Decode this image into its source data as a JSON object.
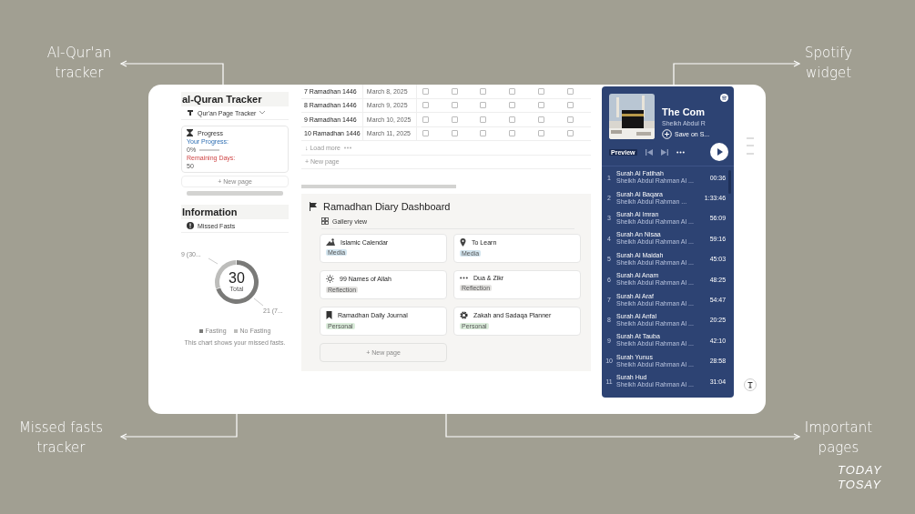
{
  "callouts": [
    "Al-Qur'an tracker",
    "Spotify widget",
    "Missed fasts tracker",
    "Important pages"
  ],
  "logo": {
    "line_1": "TODAY",
    "line_2": "TOSAY"
  },
  "quran_tracker": {
    "title": "al-Quran Tracker",
    "view": "Qur'an Page Tracker",
    "card_title": "Progress",
    "progress_label": "Your Progress:",
    "progress_value": "0%",
    "level": 0,
    "remaining_label": "Remaining Days:",
    "remaining_value": "50",
    "new_page": "+ New page"
  },
  "information": {
    "title": "Information",
    "view": "Missed Fasts",
    "center_value": "30",
    "center_label": "Total",
    "slice_labels": [
      "9 (30...",
      "21 (7..."
    ],
    "caption": "This chart shows your missed fasts.",
    "chart_data": {
      "type": "donut",
      "categories": [
        "Fasting",
        "No Fasting"
      ],
      "values": [
        70,
        30
      ]
    }
  },
  "table": {
    "rows": [
      {
        "day": "7 Ramadhan 1446",
        "date": "March 8, 2025",
        "checks": [
          false,
          false,
          false,
          false,
          false,
          false
        ]
      },
      {
        "day": "8 Ramadhan 1446",
        "date": "March 9, 2025",
        "checks": [
          false,
          false,
          false,
          false,
          false,
          false
        ]
      },
      {
        "day": "9 Ramadhan 1446",
        "date": "March 10, 2025",
        "checks": [
          false,
          false,
          false,
          false,
          false,
          false
        ]
      },
      {
        "day": "10 Ramadhan 1446",
        "date": "March 11, 2025",
        "checks": [
          false,
          false,
          false,
          false,
          false,
          false
        ]
      }
    ],
    "load_more": "↓ Load more",
    "new_page": "+ New page"
  },
  "dashboard": {
    "title": "Ramadhan Diary Dashboard",
    "view": "Gallery view",
    "new_page": "+ New page",
    "cards": [
      {
        "title": "Islamic Calendar",
        "tag": "Media",
        "color": "#d3e5ef"
      },
      {
        "title": "To Learn",
        "tag": "Media",
        "color": "#d3e5ef"
      },
      {
        "title": "99 Names of Allah",
        "tag": "Reflection",
        "color": "#e3e2e0"
      },
      {
        "title": "Dua & Zikr",
        "tag": "Reflection",
        "color": "#e3e2e0"
      },
      {
        "title": "Ramadhan Daily Journal",
        "tag": "Personal",
        "color": "#dbeddb"
      },
      {
        "title": "Zakah and Sadaqa Planner",
        "tag": "Personal",
        "color": "#dbeddb"
      }
    ]
  },
  "spotify": {
    "title": "The Com",
    "artist": "Sheikh Abdul R",
    "save": "Save on S...",
    "badge": "Preview",
    "tracks": [
      {
        "n": "1",
        "title": "Surah Al Fatihah",
        "artist": "Sheikh Abdul Rahman Al ...",
        "time": "00:36"
      },
      {
        "n": "2",
        "title": "Surah Al Baqara",
        "artist": "Sheikh Abdul Rahman ...",
        "time": "1:33:46"
      },
      {
        "n": "3",
        "title": "Surah Al Imran",
        "artist": "Sheikh Abdul Rahman Al ...",
        "time": "56:09"
      },
      {
        "n": "4",
        "title": "Surah An Nisaa",
        "artist": "Sheikh Abdul Rahman Al ...",
        "time": "59:16"
      },
      {
        "n": "5",
        "title": "Surah Al Maidah",
        "artist": "Sheikh Abdul Rahman Al ...",
        "time": "45:03"
      },
      {
        "n": "6",
        "title": "Surah Al Anam",
        "artist": "Sheikh Abdul Rahman Al ...",
        "time": "48:25"
      },
      {
        "n": "7",
        "title": "Surah Al Araf",
        "artist": "Sheikh Abdul Rahman Al ...",
        "time": "54:47"
      },
      {
        "n": "8",
        "title": "Surah Al Anfal",
        "artist": "Sheikh Abdul Rahman Al ...",
        "time": "20:25"
      },
      {
        "n": "9",
        "title": "Surah At Tauba",
        "artist": "Sheikh Abdul Rahman Al ...",
        "time": "42:10"
      },
      {
        "n": "10",
        "title": "Surah Yunus",
        "artist": "Sheikh Abdul Rahman Al ...",
        "time": "28:58"
      },
      {
        "n": "11",
        "title": "Surah Hud",
        "artist": "Sheikh Abdul Rahman Al ...",
        "time": "31:04"
      }
    ]
  }
}
